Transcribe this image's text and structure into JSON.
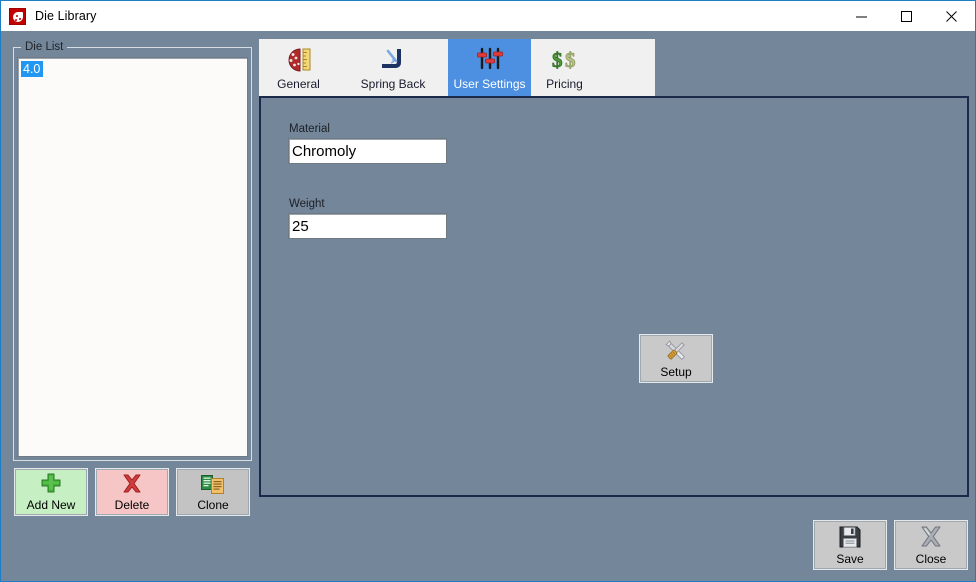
{
  "window": {
    "title": "Die Library",
    "app_icon": "die-app-icon",
    "controls": {
      "minimize": "minimize-icon",
      "maximize": "maximize-icon",
      "close": "close-icon"
    }
  },
  "theme": {
    "background": "#74869a",
    "titlebar_background": "#ffffff",
    "window_border": "#1d7ec4",
    "selection_blue": "#2196f3",
    "tab_selected": "#4d90e2",
    "tab_strip": "#f0f0f0",
    "panel_border": "#1b2a4a",
    "add_button": "#c6f0c4",
    "delete_button": "#f6c6c6",
    "neutral_button": "#c9c9c9"
  },
  "die_list": {
    "legend": "Die List",
    "items": [
      {
        "label": "4.0",
        "selected": true
      }
    ]
  },
  "list_actions": [
    {
      "label": "Add New",
      "icon": "plus-icon",
      "name": "add-new-button"
    },
    {
      "label": "Delete",
      "icon": "x-mark-icon",
      "name": "delete-button"
    },
    {
      "label": "Clone",
      "icon": "copy-documents-icon",
      "name": "clone-button"
    }
  ],
  "tabs": [
    {
      "label": "General",
      "icon": "die-ruler-icon",
      "selected": false
    },
    {
      "label": "Spring Back",
      "icon": "bend-angle-icon",
      "selected": false
    },
    {
      "label": "User Settings",
      "icon": "sliders-icon",
      "selected": true
    },
    {
      "label": "Pricing",
      "icon": "dollar-signs-icon",
      "selected": false
    }
  ],
  "user_settings": {
    "material": {
      "label": "Material",
      "value": "Chromoly",
      "placeholder": ""
    },
    "weight": {
      "label": "Weight",
      "value": "25",
      "placeholder": ""
    },
    "setup_button": {
      "label": "Setup",
      "icon": "tools-icon"
    }
  },
  "dialog_actions": [
    {
      "label": "Save",
      "icon": "floppy-disk-icon",
      "name": "save-button"
    },
    {
      "label": "Close",
      "icon": "x-close-icon",
      "name": "close-button"
    }
  ]
}
